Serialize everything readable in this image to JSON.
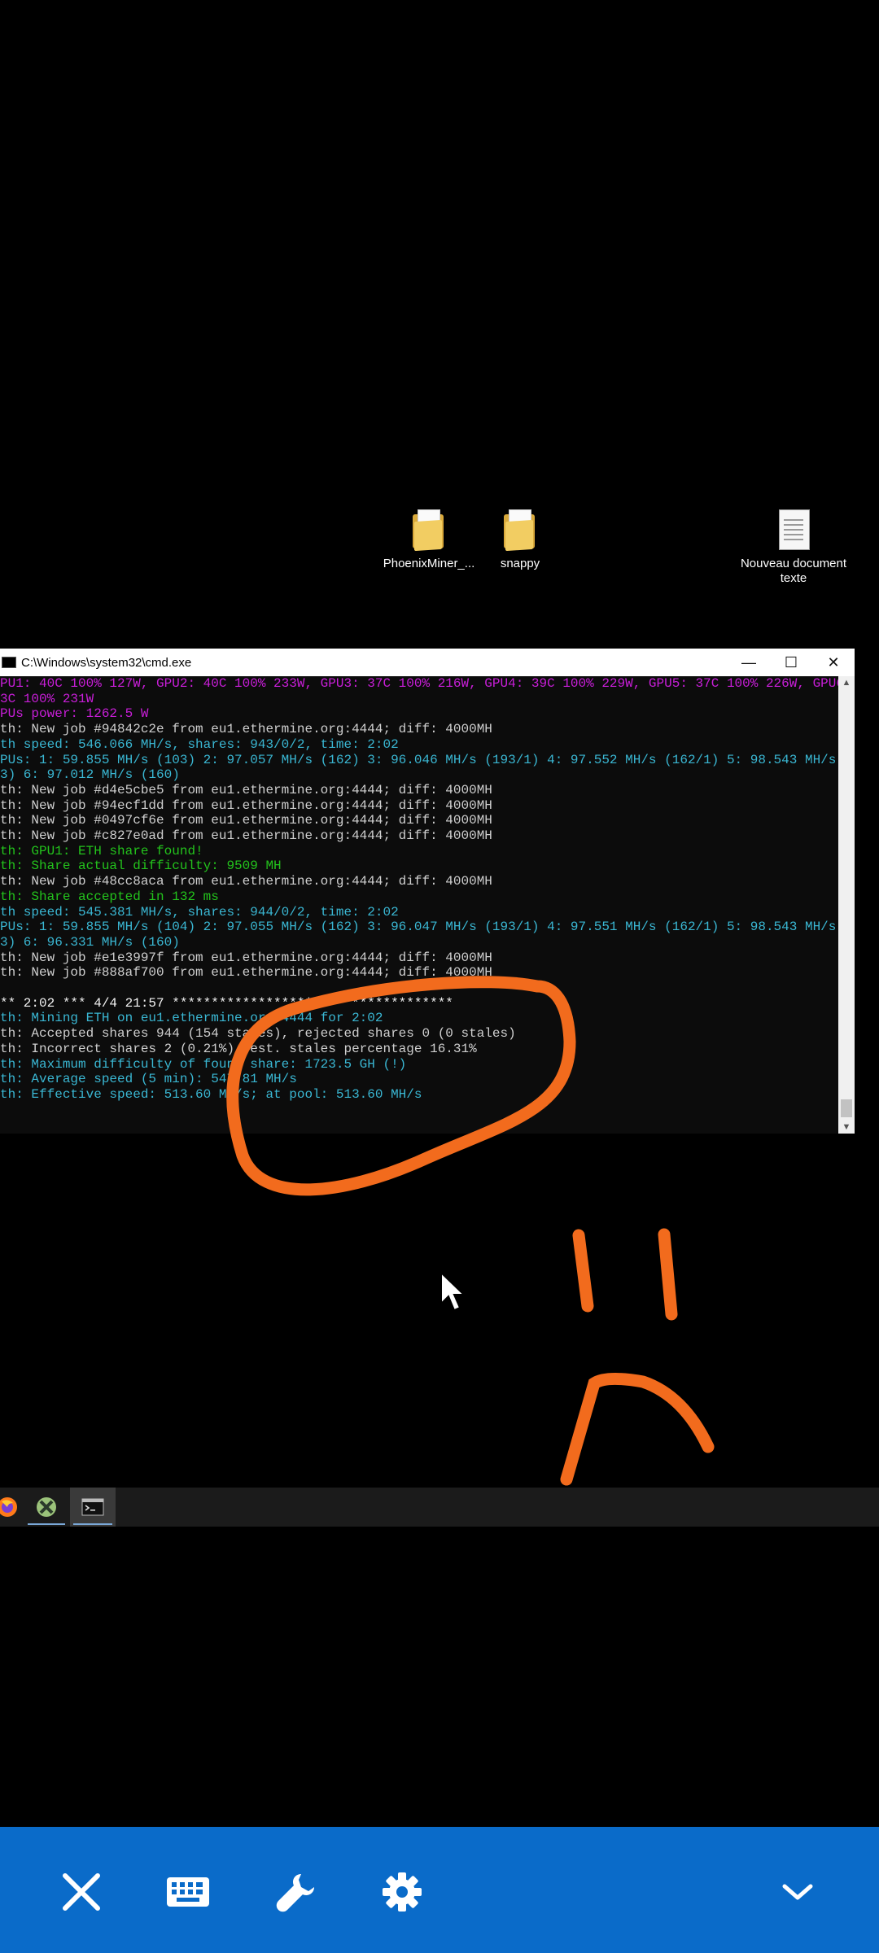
{
  "desktop": {
    "icons": [
      {
        "label": "PhoenixMiner_...",
        "type": "folder"
      },
      {
        "label": "snappy",
        "type": "folder"
      },
      {
        "label": "Nouveau document texte",
        "type": "text-document"
      }
    ]
  },
  "cmd_window": {
    "title": "C:\\Windows\\system32\\cmd.exe",
    "minimize": "—",
    "maximize": "☐",
    "close": "✕",
    "lines": [
      {
        "text": "PU1: 40C 100% 127W, GPU2: 40C 100% 233W, GPU3: 37C 100% 216W, GPU4: 39C 100% 229W, GPU5: 37C 100% 226W, GPU6:",
        "color": "#c81ed8"
      },
      {
        "text": "3C 100% 231W",
        "color": "#c81ed8"
      },
      {
        "text": "PUs power: 1262.5 W",
        "color": "#c81ed8"
      },
      {
        "text": "th: New job #94842c2e from eu1.ethermine.org:4444; diff: 4000MH",
        "color": "#cfcfcf"
      },
      {
        "text": "th speed: 546.066 MH/s, shares: 943/0/2, time: 2:02",
        "color": "#3ab7d3"
      },
      {
        "text": "PUs: 1: 59.855 MH/s (103) 2: 97.057 MH/s (162) 3: 96.046 MH/s (193/1) 4: 97.552 MH/s (162/1) 5: 98.543 MH/s (1",
        "color": "#3ab7d3"
      },
      {
        "text": "3) 6: 97.012 MH/s (160)",
        "color": "#3ab7d3"
      },
      {
        "text": "th: New job #d4e5cbe5 from eu1.ethermine.org:4444; diff: 4000MH",
        "color": "#cfcfcf"
      },
      {
        "text": "th: New job #94ecf1dd from eu1.ethermine.org:4444; diff: 4000MH",
        "color": "#cfcfcf"
      },
      {
        "text": "th: New job #0497cf6e from eu1.ethermine.org:4444; diff: 4000MH",
        "color": "#cfcfcf"
      },
      {
        "text": "th: New job #c827e0ad from eu1.ethermine.org:4444; diff: 4000MH",
        "color": "#cfcfcf"
      },
      {
        "text": "th: GPU1: ETH share found!",
        "color": "#23c31c"
      },
      {
        "text": "th: Share actual difficulty: 9509 MH",
        "color": "#23c31c"
      },
      {
        "text": "th: New job #48cc8aca from eu1.ethermine.org:4444; diff: 4000MH",
        "color": "#cfcfcf"
      },
      {
        "text": "th: Share accepted in 132 ms",
        "color": "#23c31c"
      },
      {
        "text": "th speed: 545.381 MH/s, shares: 944/0/2, time: 2:02",
        "color": "#3ab7d3"
      },
      {
        "text": "PUs: 1: 59.855 MH/s (104) 2: 97.055 MH/s (162) 3: 96.047 MH/s (193/1) 4: 97.551 MH/s (162/1) 5: 98.543 MH/s (1",
        "color": "#3ab7d3"
      },
      {
        "text": "3) 6: 96.331 MH/s (160)",
        "color": "#3ab7d3"
      },
      {
        "text": "th: New job #e1e3997f from eu1.ethermine.org:4444; diff: 4000MH",
        "color": "#cfcfcf"
      },
      {
        "text": "th: New job #888af700 from eu1.ethermine.org:4444; diff: 4000MH",
        "color": "#cfcfcf"
      },
      {
        "text": "",
        "color": "#cfcfcf"
      },
      {
        "text": "** 2:02 *** 4/4 21:57 ************************************",
        "color": "#f2f2f2"
      },
      {
        "text": "th: Mining ETH on eu1.ethermine.org:4444 for 2:02",
        "color": "#3ab7d3"
      },
      {
        "text": "th: Accepted shares 944 (154 stales), rejected shares 0 (0 stales)",
        "color": "#cfcfcf"
      },
      {
        "text": "th: Incorrect shares 2 (0.21%), est. stales percentage 16.31%",
        "color": "#cfcfcf"
      },
      {
        "text": "th: Maximum difficulty of found share: 1723.5 GH (!)",
        "color": "#3ab7d3"
      },
      {
        "text": "th: Average speed (5 min): 547.81 MH/s",
        "color": "#3ab7d3"
      },
      {
        "text": "th: Effective speed: 513.60 MH/s; at pool: 513.60 MH/s",
        "color": "#3ab7d3"
      }
    ]
  },
  "taskbar": {
    "items": [
      {
        "name": "firefox-icon"
      },
      {
        "name": "xbox-app-icon"
      },
      {
        "name": "cmd-icon",
        "active": true
      }
    ]
  },
  "toolbar": {
    "buttons": [
      {
        "name": "close-icon"
      },
      {
        "name": "keyboard-icon"
      },
      {
        "name": "wrench-icon"
      },
      {
        "name": "gear-icon"
      },
      {
        "name": "chevron-down-icon"
      }
    ]
  },
  "annotation": {
    "color": "#f26b1d",
    "description_icon": "sad-face-drawing"
  }
}
